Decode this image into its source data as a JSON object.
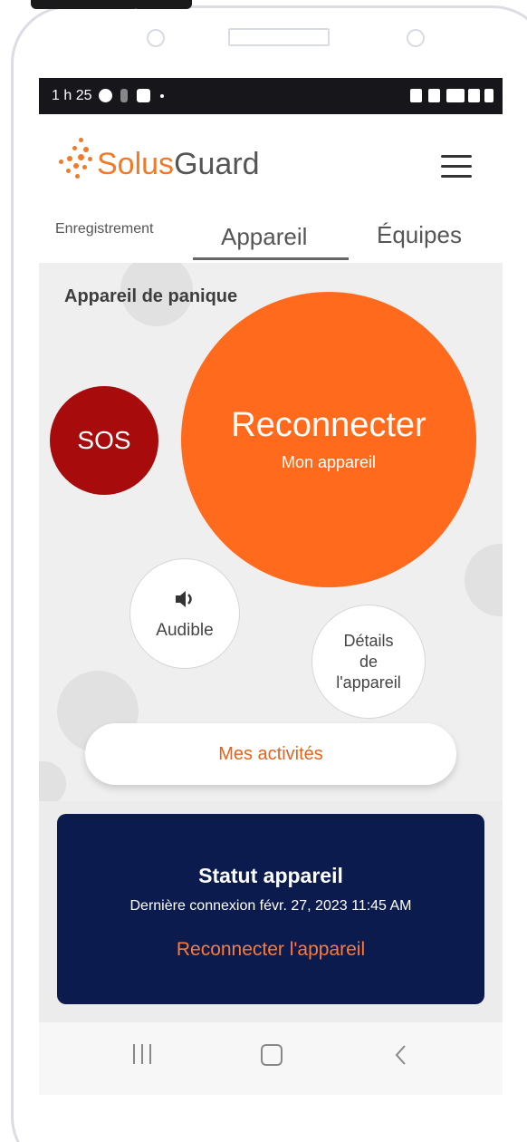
{
  "status_bar": {
    "time": "1 h 25"
  },
  "header": {
    "brand_part1": "Solus",
    "brand_part2": "Guard"
  },
  "tabs": [
    {
      "label": "Enregistrement",
      "active": false
    },
    {
      "label": "Appareil",
      "active": true
    },
    {
      "label": "Équipes",
      "active": false
    }
  ],
  "panic": {
    "title": "Appareil de panique",
    "sos_label": "SOS",
    "reconnect_label": "Reconnecter",
    "reconnect_sub": "Mon appareil",
    "audible_label": "Audible",
    "details_label_1": "Détails",
    "details_label_2": "de",
    "details_label_3": "l'appareil",
    "activities_label": "Mes activités"
  },
  "device_status": {
    "title": "Statut appareil",
    "last_connection": "Dernière connexion févr. 27, 2023 11:45 AM",
    "reconnect_link": "Reconnecter l'appareil"
  },
  "colors": {
    "brand_orange": "#f07a26",
    "reconnect_orange": "#ff6a1c",
    "sos_red": "#a70b0b",
    "status_navy": "#0b1b4d"
  },
  "icons": {
    "menu": "hamburger-icon",
    "audible": "speaker-icon",
    "nav_recents": "recents-icon",
    "nav_home": "home-icon",
    "nav_back": "back-icon"
  }
}
